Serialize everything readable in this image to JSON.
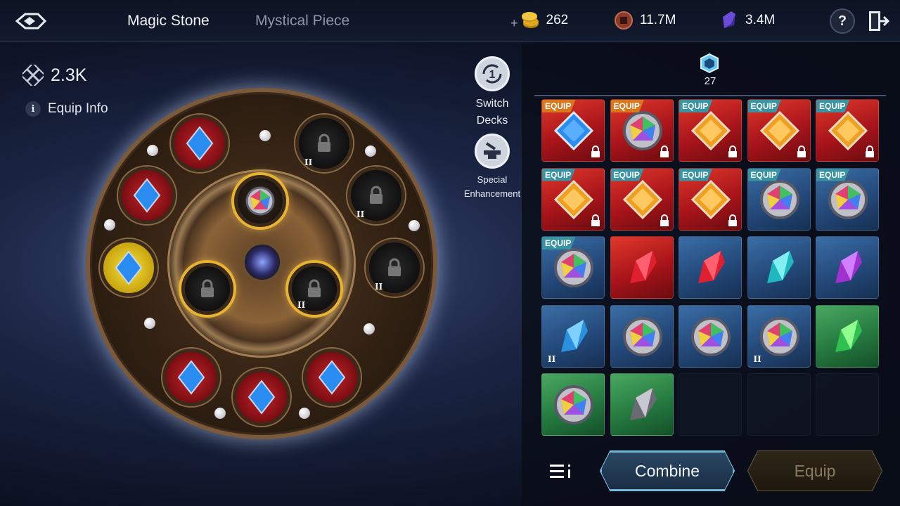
{
  "header": {
    "tabs": [
      {
        "label": "Magic Stone",
        "active": true
      },
      {
        "label": "Mystical Piece",
        "active": false
      }
    ],
    "currencies": [
      {
        "icon": "gold-coin-icon",
        "value": "262",
        "add": "+"
      },
      {
        "icon": "bronze-coin-icon",
        "value": "11.7M"
      },
      {
        "icon": "purple-crystal-icon",
        "value": "3.4M"
      }
    ],
    "help_label": "?"
  },
  "left": {
    "power_value": "2.3K",
    "equip_info_label": "Equip Info",
    "switch_decks": {
      "number": "1",
      "label_line1": "Switch",
      "label_line2": "Decks"
    },
    "special_enhancement": {
      "label_line1": "Special",
      "label_line2": "Enhancement"
    },
    "slot_tier_label": "II"
  },
  "right": {
    "stone_count": "27",
    "equip_tag": "EQUIP",
    "tier_label": "II",
    "inventory": [
      {
        "bg": "red",
        "gem": "blue-diamond",
        "tag": "orange",
        "locked": true
      },
      {
        "bg": "red",
        "gem": "rainbow-orb",
        "tag": "orange",
        "locked": true
      },
      {
        "bg": "red",
        "gem": "orange-diamond",
        "tag": "teal",
        "locked": true
      },
      {
        "bg": "red",
        "gem": "orange-diamond",
        "tag": "teal",
        "locked": true
      },
      {
        "bg": "red",
        "gem": "orange-diamond",
        "tag": "teal",
        "locked": true
      },
      {
        "bg": "red",
        "gem": "orange-diamond",
        "tag": "teal",
        "locked": true
      },
      {
        "bg": "red",
        "gem": "orange-diamond",
        "tag": "teal",
        "locked": true
      },
      {
        "bg": "red",
        "gem": "orange-diamond",
        "tag": "teal",
        "locked": true
      },
      {
        "bg": "blue",
        "gem": "rainbow-orb",
        "tag": "teal",
        "locked": false
      },
      {
        "bg": "blue",
        "gem": "rainbow-orb",
        "tag": "teal",
        "locked": false
      },
      {
        "bg": "blue",
        "gem": "rainbow-orb",
        "tag": "teal",
        "locked": false
      },
      {
        "bg": "red",
        "gem": "red-shard",
        "tag": null,
        "locked": false
      },
      {
        "bg": "blue",
        "gem": "red-shard",
        "tag": null,
        "locked": false
      },
      {
        "bg": "blue",
        "gem": "teal-shard",
        "tag": null,
        "locked": false
      },
      {
        "bg": "blue",
        "gem": "purple-shard",
        "tag": null,
        "locked": false
      },
      {
        "bg": "blue",
        "gem": "blue-shard",
        "tag": null,
        "locked": false,
        "tier": true
      },
      {
        "bg": "blue",
        "gem": "rainbow-orb",
        "tag": null,
        "locked": false
      },
      {
        "bg": "blue",
        "gem": "rainbow-orb",
        "tag": null,
        "locked": false
      },
      {
        "bg": "blue",
        "gem": "rainbow-orb",
        "tag": null,
        "locked": false,
        "tier": true
      },
      {
        "bg": "green",
        "gem": "green-shard",
        "tag": null,
        "locked": false
      },
      {
        "bg": "green",
        "gem": "rainbow-orb",
        "tag": null,
        "locked": false
      },
      {
        "bg": "green",
        "gem": "grey-shard",
        "tag": null,
        "locked": false
      },
      {
        "bg": "empty"
      },
      {
        "bg": "empty"
      },
      {
        "bg": "empty"
      }
    ],
    "combine_label": "Combine",
    "equip_label": "Equip"
  },
  "colors": {
    "accent_gold": "#e8b430",
    "equip_tag_orange": "#d9771c",
    "equip_tag_teal": "#3a93a3",
    "cell_red": "#a8141a",
    "cell_blue": "#24497a",
    "cell_green": "#257a40"
  }
}
